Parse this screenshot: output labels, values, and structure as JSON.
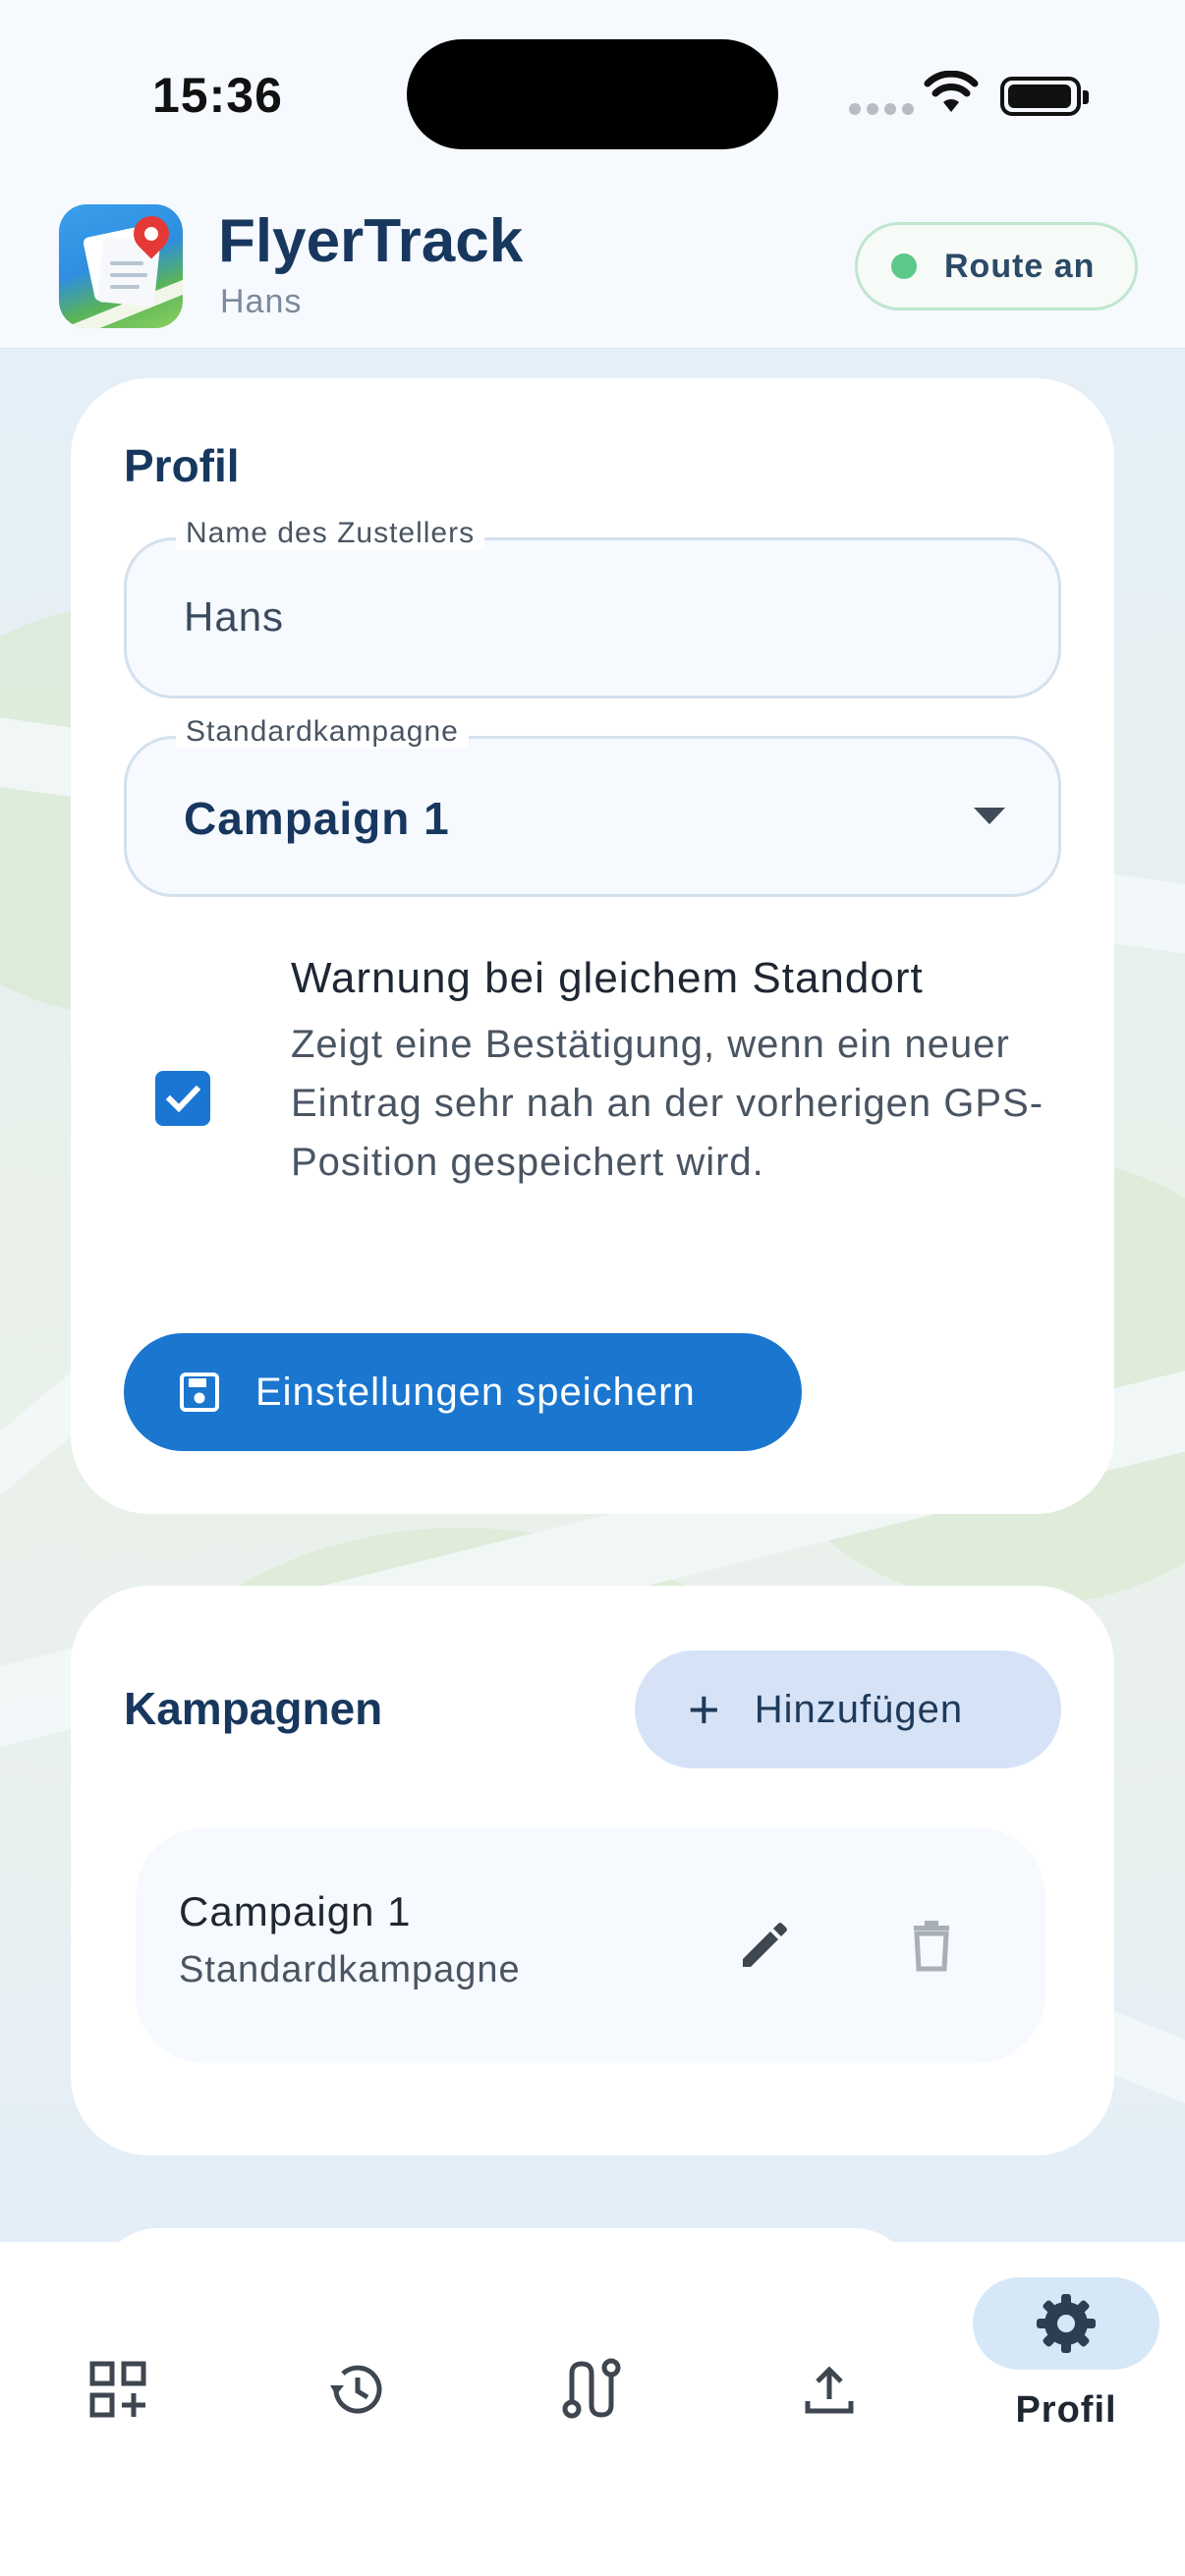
{
  "status_bar": {
    "time": "15:36"
  },
  "header": {
    "app_title": "FlyerTrack",
    "user_name": "Hans",
    "route_status": "Route an",
    "route_status_color": "#5cc98b"
  },
  "profile": {
    "title": "Profil",
    "name_field": {
      "label": "Name des Zustellers",
      "value": "Hans"
    },
    "campaign_field": {
      "label": "Standardkampagne",
      "value": "Campaign 1"
    },
    "warning": {
      "checked": true,
      "title": "Warnung bei gleichem Standort",
      "description": "Zeigt eine Bestätigung, wenn ein neuer Eintrag sehr nah an der vorherigen GPS-Position gespeichert wird."
    },
    "save_button": "Einstellungen speichern"
  },
  "campaigns": {
    "title": "Kampagnen",
    "add_button": "Hinzufügen",
    "items": [
      {
        "name": "Campaign 1",
        "subtitle": "Standardkampagne"
      }
    ]
  },
  "bottom_nav": {
    "items": [
      {
        "icon": "qr-add-icon"
      },
      {
        "icon": "history-icon"
      },
      {
        "icon": "route-icon"
      },
      {
        "icon": "upload-icon"
      },
      {
        "icon": "gear-icon",
        "label": "Profil",
        "active": true
      }
    ]
  },
  "colors": {
    "primary": "#1a76cf",
    "title": "#17375e",
    "tonal": "#d6e3f7"
  }
}
